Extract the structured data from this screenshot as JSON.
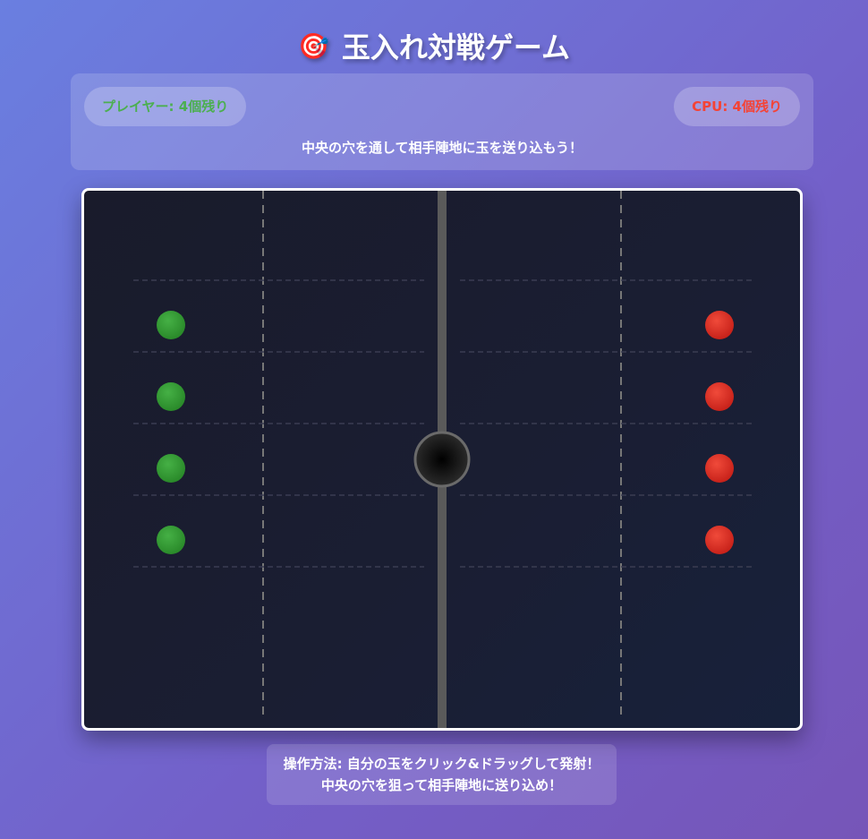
{
  "header": {
    "icon": "🎯",
    "icon_name": "target-icon",
    "title": "玉入れ対戦ゲーム"
  },
  "scoreboard": {
    "player": "プレイヤー: 4個残り",
    "cpu": "CPU: 4個残り",
    "hint": "中央の穴を通して相手陣地に玉を送り込もう！",
    "player_color": "#4caf50",
    "cpu_color": "#f44336"
  },
  "game": {
    "player_balls": 4,
    "cpu_balls": 4,
    "player_ball_color": "#3a9a3a",
    "cpu_ball_color": "#e0302a"
  },
  "instructions": {
    "label": "操作方法:",
    "line1": "自分の玉をクリック&ドラッグして発射！",
    "line2": "中央の穴を狙って相手陣地に送り込め！"
  }
}
